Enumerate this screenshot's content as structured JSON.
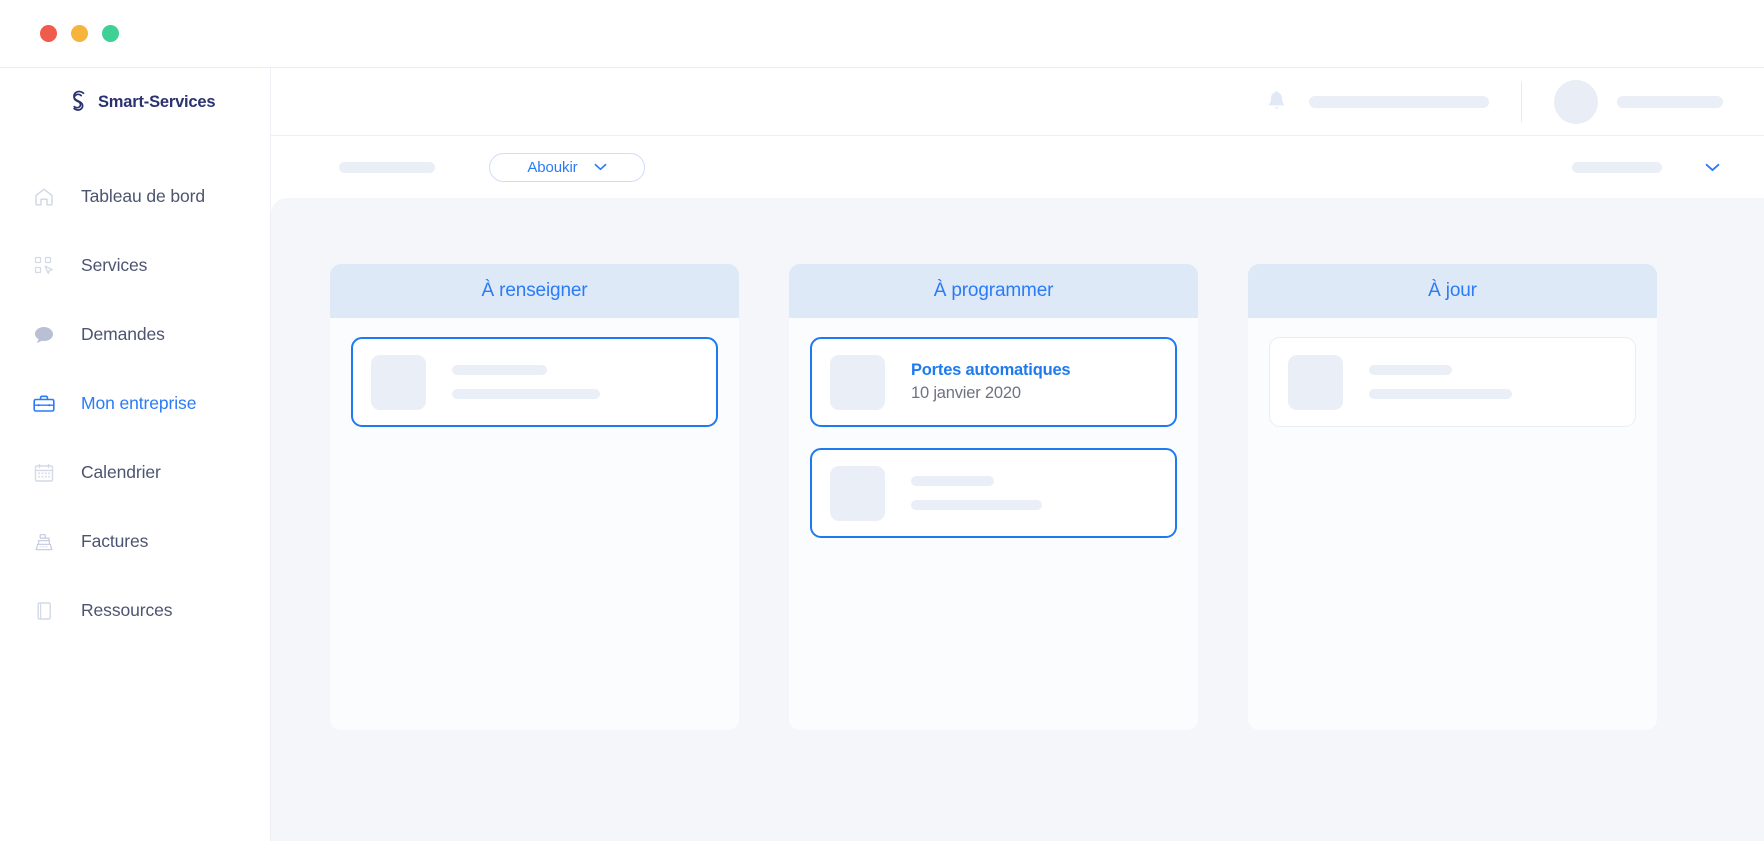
{
  "window": {
    "traffic_lights": [
      {
        "name": "close",
        "color": "#ef5b4c"
      },
      {
        "name": "minimize",
        "color": "#f6b43c"
      },
      {
        "name": "zoom",
        "color": "#3ed094"
      }
    ]
  },
  "brand": {
    "name": "Smart-Services",
    "logo_icon": "smart-services-s-logo",
    "color": "#2b3270"
  },
  "sidebar": {
    "items": [
      {
        "label": "Tableau de bord",
        "icon": "home-icon",
        "active": false
      },
      {
        "label": "Services",
        "icon": "services-icon",
        "active": false
      },
      {
        "label": "Demandes",
        "icon": "chat-icon",
        "active": false
      },
      {
        "label": "Mon entreprise",
        "icon": "briefcase-icon",
        "active": true
      },
      {
        "label": "Calendrier",
        "icon": "calendar-icon",
        "active": false
      },
      {
        "label": "Factures",
        "icon": "register-icon",
        "active": false
      },
      {
        "label": "Ressources",
        "icon": "book-icon",
        "active": false
      }
    ],
    "active_color": "#2a7bf5",
    "inactive_color": "#4d5470"
  },
  "header": {
    "notification_icon": "bell-icon",
    "user_name_placeholder": "",
    "avatar_icon": "avatar",
    "user_label_placeholder": ""
  },
  "toolbar": {
    "breadcrumb_placeholder": "",
    "site_select": {
      "label": "Aboukir",
      "chevron_icon": "chevron-down-icon",
      "color": "#2a7bf5"
    },
    "right_placeholder": "",
    "right_chevron_icon": "chevron-down-icon"
  },
  "board": {
    "accent_color": "#1f7aef",
    "header_bg": "#dee9f8",
    "columns": [
      {
        "title": "À renseigner",
        "cards": [
          {
            "type": "skeleton",
            "highlighted": true
          }
        ]
      },
      {
        "title": "À programmer",
        "cards": [
          {
            "type": "content",
            "highlighted": true,
            "title": "Portes automatiques",
            "subtitle": "10 janvier 2020"
          },
          {
            "type": "skeleton",
            "highlighted": true
          }
        ]
      },
      {
        "title": "À jour",
        "cards": [
          {
            "type": "skeleton",
            "highlighted": false
          }
        ]
      }
    ]
  }
}
